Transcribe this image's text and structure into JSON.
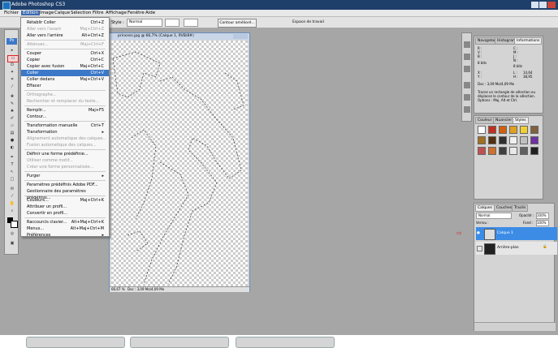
{
  "window": {
    "title": "Adobe Photoshop CS3"
  },
  "menu": [
    "Fichier",
    "Edition",
    "Image",
    "Calque",
    "Sélection",
    "Filtre",
    "Affichage",
    "Fenêtre",
    "Aide"
  ],
  "options": {
    "style_label": "Style :",
    "style_value": "Normal",
    "refine_edge": "Contour amélioré...",
    "workspace": "Espace de travail"
  },
  "document": {
    "title": "princess.jpg @ 66,7% (Calque 1, RVB/8#)",
    "zoom": "66,67 %",
    "doc_info": "Doc : 3,09 Mo/4,09 Mo"
  },
  "edit_menu": [
    {
      "label": "Rétablir Coller",
      "shortcut": "Ctrl+Z",
      "disabled": false
    },
    {
      "label": "Aller vers l'avant",
      "shortcut": "Maj+Ctrl+Z",
      "disabled": true
    },
    {
      "label": "Aller vers l'arrière",
      "shortcut": "Alt+Ctrl+Z",
      "disabled": false
    },
    {
      "sep": true
    },
    {
      "label": "Atténuer...",
      "shortcut": "Maj+Ctrl+F",
      "disabled": true
    },
    {
      "sep": true
    },
    {
      "label": "Couper",
      "shortcut": "Ctrl+X",
      "disabled": false
    },
    {
      "label": "Copier",
      "shortcut": "Ctrl+C",
      "disabled": false
    },
    {
      "label": "Copier avec fusion",
      "shortcut": "Maj+Ctrl+C",
      "disabled": false
    },
    {
      "label": "Coller",
      "shortcut": "Ctrl+V",
      "disabled": false,
      "highlight": true
    },
    {
      "label": "Coller dedans",
      "shortcut": "Maj+Ctrl+V",
      "disabled": false
    },
    {
      "label": "Effacer",
      "shortcut": "",
      "disabled": false
    },
    {
      "sep": true
    },
    {
      "label": "Orthographe...",
      "shortcut": "",
      "disabled": true
    },
    {
      "label": "Rechercher et remplacer du texte...",
      "shortcut": "",
      "disabled": true
    },
    {
      "sep": true
    },
    {
      "label": "Remplir...",
      "shortcut": "Maj+F5",
      "disabled": false
    },
    {
      "label": "Contour...",
      "shortcut": "",
      "disabled": false
    },
    {
      "sep": true
    },
    {
      "label": "Transformation manuelle",
      "shortcut": "Ctrl+T",
      "disabled": false
    },
    {
      "label": "Transformation",
      "shortcut": "▸",
      "disabled": false
    },
    {
      "label": "Alignement automatique des calques...",
      "shortcut": "",
      "disabled": true
    },
    {
      "label": "Fusion automatique des calques...",
      "shortcut": "",
      "disabled": true
    },
    {
      "sep": true
    },
    {
      "label": "Définir une forme prédéfinie...",
      "shortcut": "",
      "disabled": false
    },
    {
      "label": "Utiliser comme motif...",
      "shortcut": "",
      "disabled": true
    },
    {
      "label": "Créer une forme personnalisée...",
      "shortcut": "",
      "disabled": true
    },
    {
      "sep": true
    },
    {
      "label": "Purger",
      "shortcut": "▸",
      "disabled": false
    },
    {
      "sep": true
    },
    {
      "label": "Paramètres prédéfinis Adobe PDF...",
      "shortcut": "",
      "disabled": false
    },
    {
      "label": "Gestionnaire des paramètres prédéfinis...",
      "shortcut": "",
      "disabled": false
    },
    {
      "sep": true
    },
    {
      "label": "Couleurs...",
      "shortcut": "Maj+Ctrl+K",
      "disabled": false
    },
    {
      "label": "Attribuer un profil...",
      "shortcut": "",
      "disabled": false
    },
    {
      "label": "Convertir en profil...",
      "shortcut": "",
      "disabled": false
    },
    {
      "sep": true
    },
    {
      "label": "Raccourcis clavier...",
      "shortcut": "Alt+Maj+Ctrl+K",
      "disabled": false
    },
    {
      "label": "Menus...",
      "shortcut": "Alt+Maj+Ctrl+M",
      "disabled": false
    },
    {
      "label": "Préférences",
      "shortcut": "▸",
      "disabled": false
    }
  ],
  "info_panel": {
    "tabs": [
      "Navigator",
      "Histogram",
      "Informations"
    ],
    "r": "R :",
    "g": "V :",
    "b": "B :",
    "c": "C :",
    "m": "M :",
    "y": "J :",
    "k": "N :",
    "bits1": "8 bits",
    "bits2": "8 bits",
    "x": "X :",
    "yy": "Y :",
    "xv": "14,64",
    "yv": "38,95",
    "l": "L :",
    "h": "H :",
    "doc": "Doc : 3,09 Mo/4,09 Mo",
    "hint": "Tracez un rectangle de sélection ou déplacez le contour de la sélection. Options : Maj, Alt et Ctrl."
  },
  "styles_panel": {
    "tabs": [
      "Couleur",
      "Nuancier",
      "Styles"
    ]
  },
  "layers_panel": {
    "tabs": [
      "Calques",
      "Couches",
      "Tracés"
    ],
    "mode": "Normal",
    "opacity_label": "Opacité :",
    "opacity": "100%",
    "lock_label": "Verrou :",
    "fill_label": "Fond :",
    "fill": "100%",
    "layers": [
      {
        "name": "Calque 1"
      },
      {
        "name": "Arrière-plan"
      }
    ]
  },
  "colors": {
    "accent": "#3c78c8",
    "workspace": "#a6a6a6",
    "layer_selected": "#3c8ce6"
  }
}
